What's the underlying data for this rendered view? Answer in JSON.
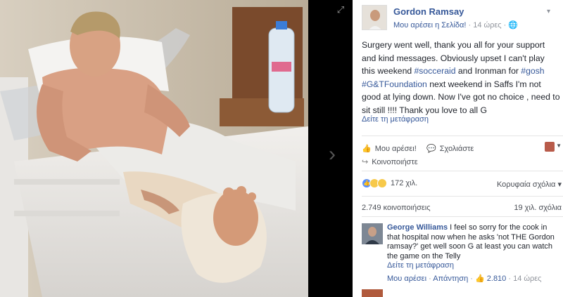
{
  "viewer": {
    "expand_icon": "expand-icon",
    "next_icon": "chevron-right-icon"
  },
  "post": {
    "author": "Gordon Ramsay",
    "liked_page": "Μου αρέσει η Σελίδα!",
    "time": "14 ώρες",
    "audience_icon": "globe-icon",
    "text_parts": [
      {
        "t": "Surgery went well, thank you all for your support and kind messages. Obviously upset I can't play this weekend ",
        "tag": false
      },
      {
        "t": "#socceraid",
        "tag": true
      },
      {
        "t": " and Ironman for ",
        "tag": false
      },
      {
        "t": "#gosh",
        "tag": true
      },
      {
        "t": " ",
        "tag": false
      },
      {
        "t": "#G&TFoundation",
        "tag": true
      },
      {
        "t": " next weekend in Saffs I'm not good at lying down. Now I've got no choice , need to sit still !!!! Thank you love to all G",
        "tag": false
      }
    ],
    "see_translation": "Δείτε τη μετάφραση"
  },
  "actions": {
    "like": "Μου αρέσει!",
    "comment": "Σχολιάστε",
    "share": "Κοινοποιήστε"
  },
  "stats": {
    "reactions_count": "172 χιλ.",
    "top_comments": "Κορυφαία σχόλια",
    "shares": "2.749 κοινοποιήσεις",
    "comments": "19 χιλ. σχόλια"
  },
  "comment": {
    "author": "George Williams",
    "text": "I feel so sorry for the cook in that hospital now when he asks 'not THE Gordon ramsay?' get well soon G at least you can watch the game on the Telly",
    "see_translation": "Δείτε τη μετάφραση",
    "like": "Μου αρέσει",
    "reply": "Απάντηση",
    "likes": "2.810",
    "time": "14 ώρες"
  },
  "colors": {
    "link": "#365899",
    "text": "#1d2129",
    "muted": "#90949c",
    "like_blue": "#5890ff"
  }
}
